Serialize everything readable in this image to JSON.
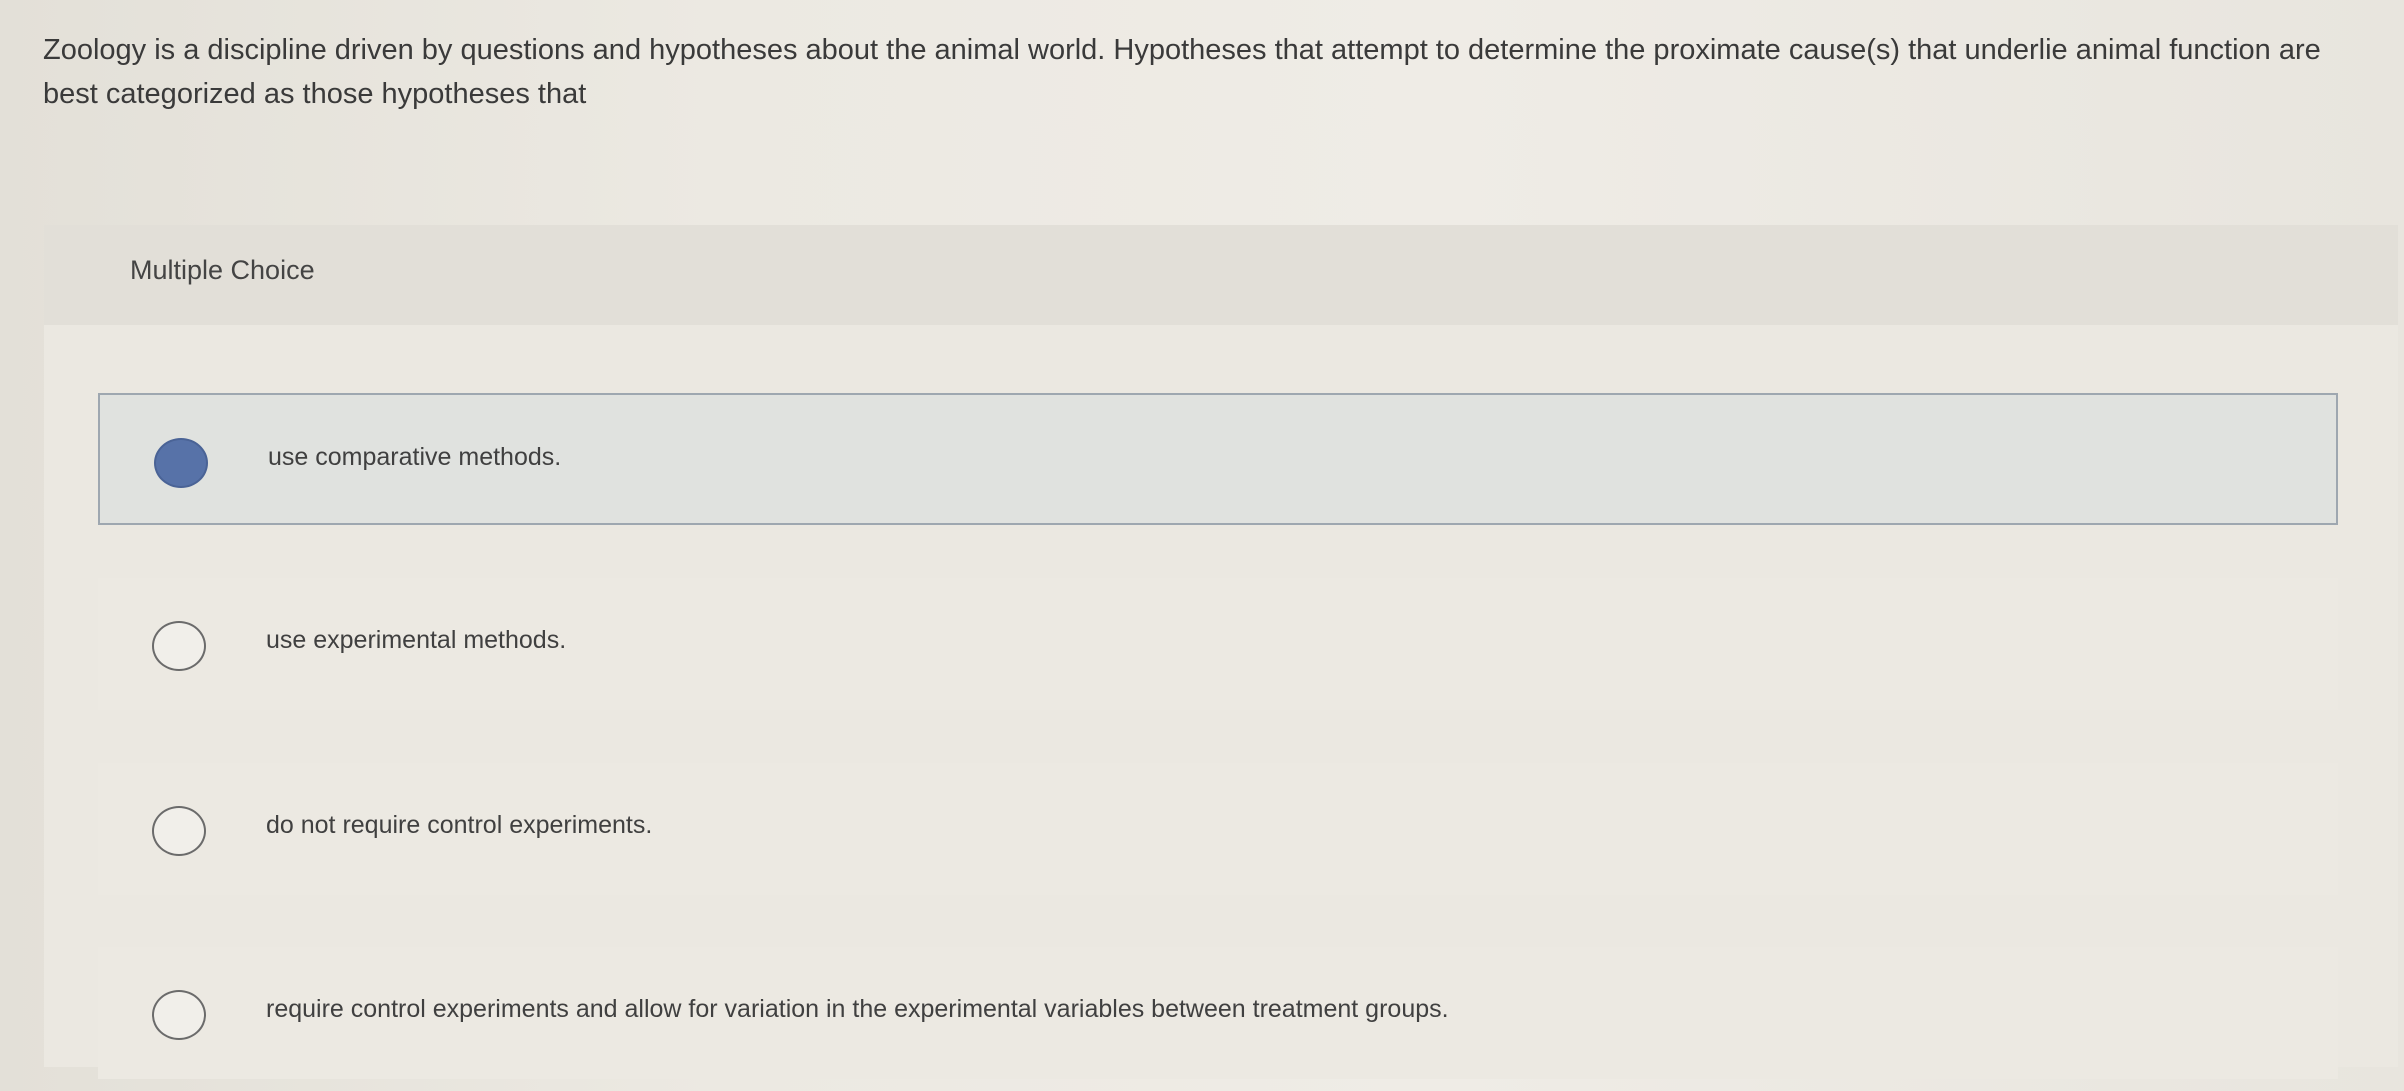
{
  "question": {
    "text": "Zoology is a discipline driven by questions and hypotheses about the animal world. Hypotheses that attempt to determine the proximate cause(s) that underlie animal function are best categorized as those hypotheses that"
  },
  "panel": {
    "header_label": "Multiple Choice"
  },
  "options": [
    {
      "label": "use comparative methods.",
      "selected": true
    },
    {
      "label": "use experimental methods.",
      "selected": false
    },
    {
      "label": "do not require control experiments.",
      "selected": false
    },
    {
      "label": "require control experiments and allow for variation in the experimental variables between treatment groups.",
      "selected": false
    }
  ],
  "colors": {
    "selected_radio": "#5772a8",
    "selected_border": "#9ea7b0"
  },
  "icons": {
    "radio_selected": "radio-filled-icon",
    "radio_unselected": "radio-empty-icon"
  }
}
